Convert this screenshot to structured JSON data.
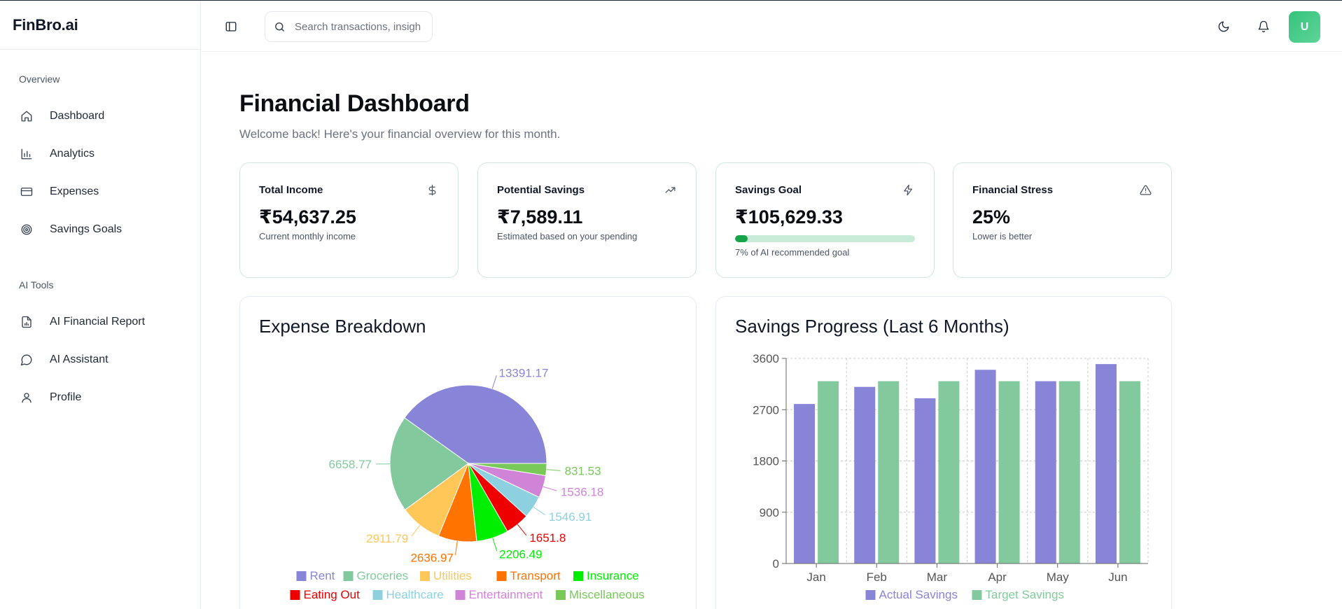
{
  "app": {
    "brand": "FinBro.ai"
  },
  "sidebar": {
    "sections": [
      {
        "label": "Overview",
        "items": [
          {
            "label": "Dashboard",
            "icon": "home-icon"
          },
          {
            "label": "Analytics",
            "icon": "bar-chart-icon"
          },
          {
            "label": "Expenses",
            "icon": "credit-card-icon"
          },
          {
            "label": "Savings Goals",
            "icon": "target-icon"
          }
        ]
      },
      {
        "label": "AI Tools",
        "items": [
          {
            "label": "AI Financial Report",
            "icon": "file-chart-icon"
          },
          {
            "label": "AI Assistant",
            "icon": "chat-bubble-icon"
          },
          {
            "label": "Profile",
            "icon": "user-icon"
          }
        ]
      }
    ]
  },
  "header": {
    "search_placeholder": "Search transactions, insights...",
    "avatar_initial": "U"
  },
  "page": {
    "title": "Financial Dashboard",
    "subtitle": "Welcome back! Here's your financial overview for this month."
  },
  "cards": [
    {
      "title": "Total Income",
      "value": "₹54,637.25",
      "note": "Current monthly income",
      "icon": "dollar-icon"
    },
    {
      "title": "Potential Savings",
      "value": "₹7,589.11",
      "note": "Estimated based on your spending",
      "icon": "trending-up-icon"
    },
    {
      "title": "Savings Goal",
      "value": "₹105,629.33",
      "note": "7% of AI recommended goal",
      "icon": "lightning-icon",
      "progress": 0.07
    },
    {
      "title": "Financial Stress",
      "value": "25%",
      "note": "Lower is better",
      "icon": "warning-icon"
    }
  ],
  "panels": {
    "expense_title": "Expense Breakdown",
    "savings_title": "Savings Progress (Last 6 Months)"
  },
  "chart_data": [
    {
      "type": "pie",
      "title": "Expense Breakdown",
      "legend_position": "bottom",
      "slices": [
        {
          "name": "Rent",
          "value": 13391.17,
          "label": "13391.17",
          "color": "#8884d8"
        },
        {
          "name": "Groceries",
          "value": 6658.77,
          "label": "6658.77",
          "color": "#82ca9d"
        },
        {
          "name": "Utilities",
          "value": 2911.79,
          "label": "2911.79",
          "color": "#ffc658"
        },
        {
          "name": "Transport",
          "value": 2636.97,
          "label": "2636.97",
          "color": "#ff7300"
        },
        {
          "name": "Insurance",
          "value": 2206.49,
          "label": "2206.49",
          "color": "#00ee00"
        },
        {
          "name": "Eating Out",
          "value": 1651.8,
          "label": "1651.8",
          "color": "#ee0000"
        },
        {
          "name": "Healthcare",
          "value": 1546.91,
          "label": "1546.91",
          "color": "#8dd1e1"
        },
        {
          "name": "Entertainment",
          "value": 1536.18,
          "label": "1536.18",
          "color": "#d084d8"
        },
        {
          "name": "Miscellaneous",
          "value": 831.53,
          "label": "831.53",
          "color": "#79c85a"
        }
      ]
    },
    {
      "type": "bar",
      "title": "Savings Progress (Last 6 Months)",
      "categories": [
        "Jan",
        "Feb",
        "Mar",
        "Apr",
        "May",
        "Jun"
      ],
      "series": [
        {
          "name": "Actual Savings",
          "color": "#8884d8",
          "values": [
            2800,
            3100,
            2900,
            3400,
            3200,
            3500
          ]
        },
        {
          "name": "Target Savings",
          "color": "#82ca9d",
          "values": [
            3200,
            3200,
            3200,
            3200,
            3200,
            3200
          ]
        }
      ],
      "y_ticks": [
        "0",
        "900",
        "1800",
        "2700",
        "3600"
      ],
      "ylim": [
        0,
        3600
      ],
      "grid": true,
      "legend_position": "bottom"
    }
  ]
}
